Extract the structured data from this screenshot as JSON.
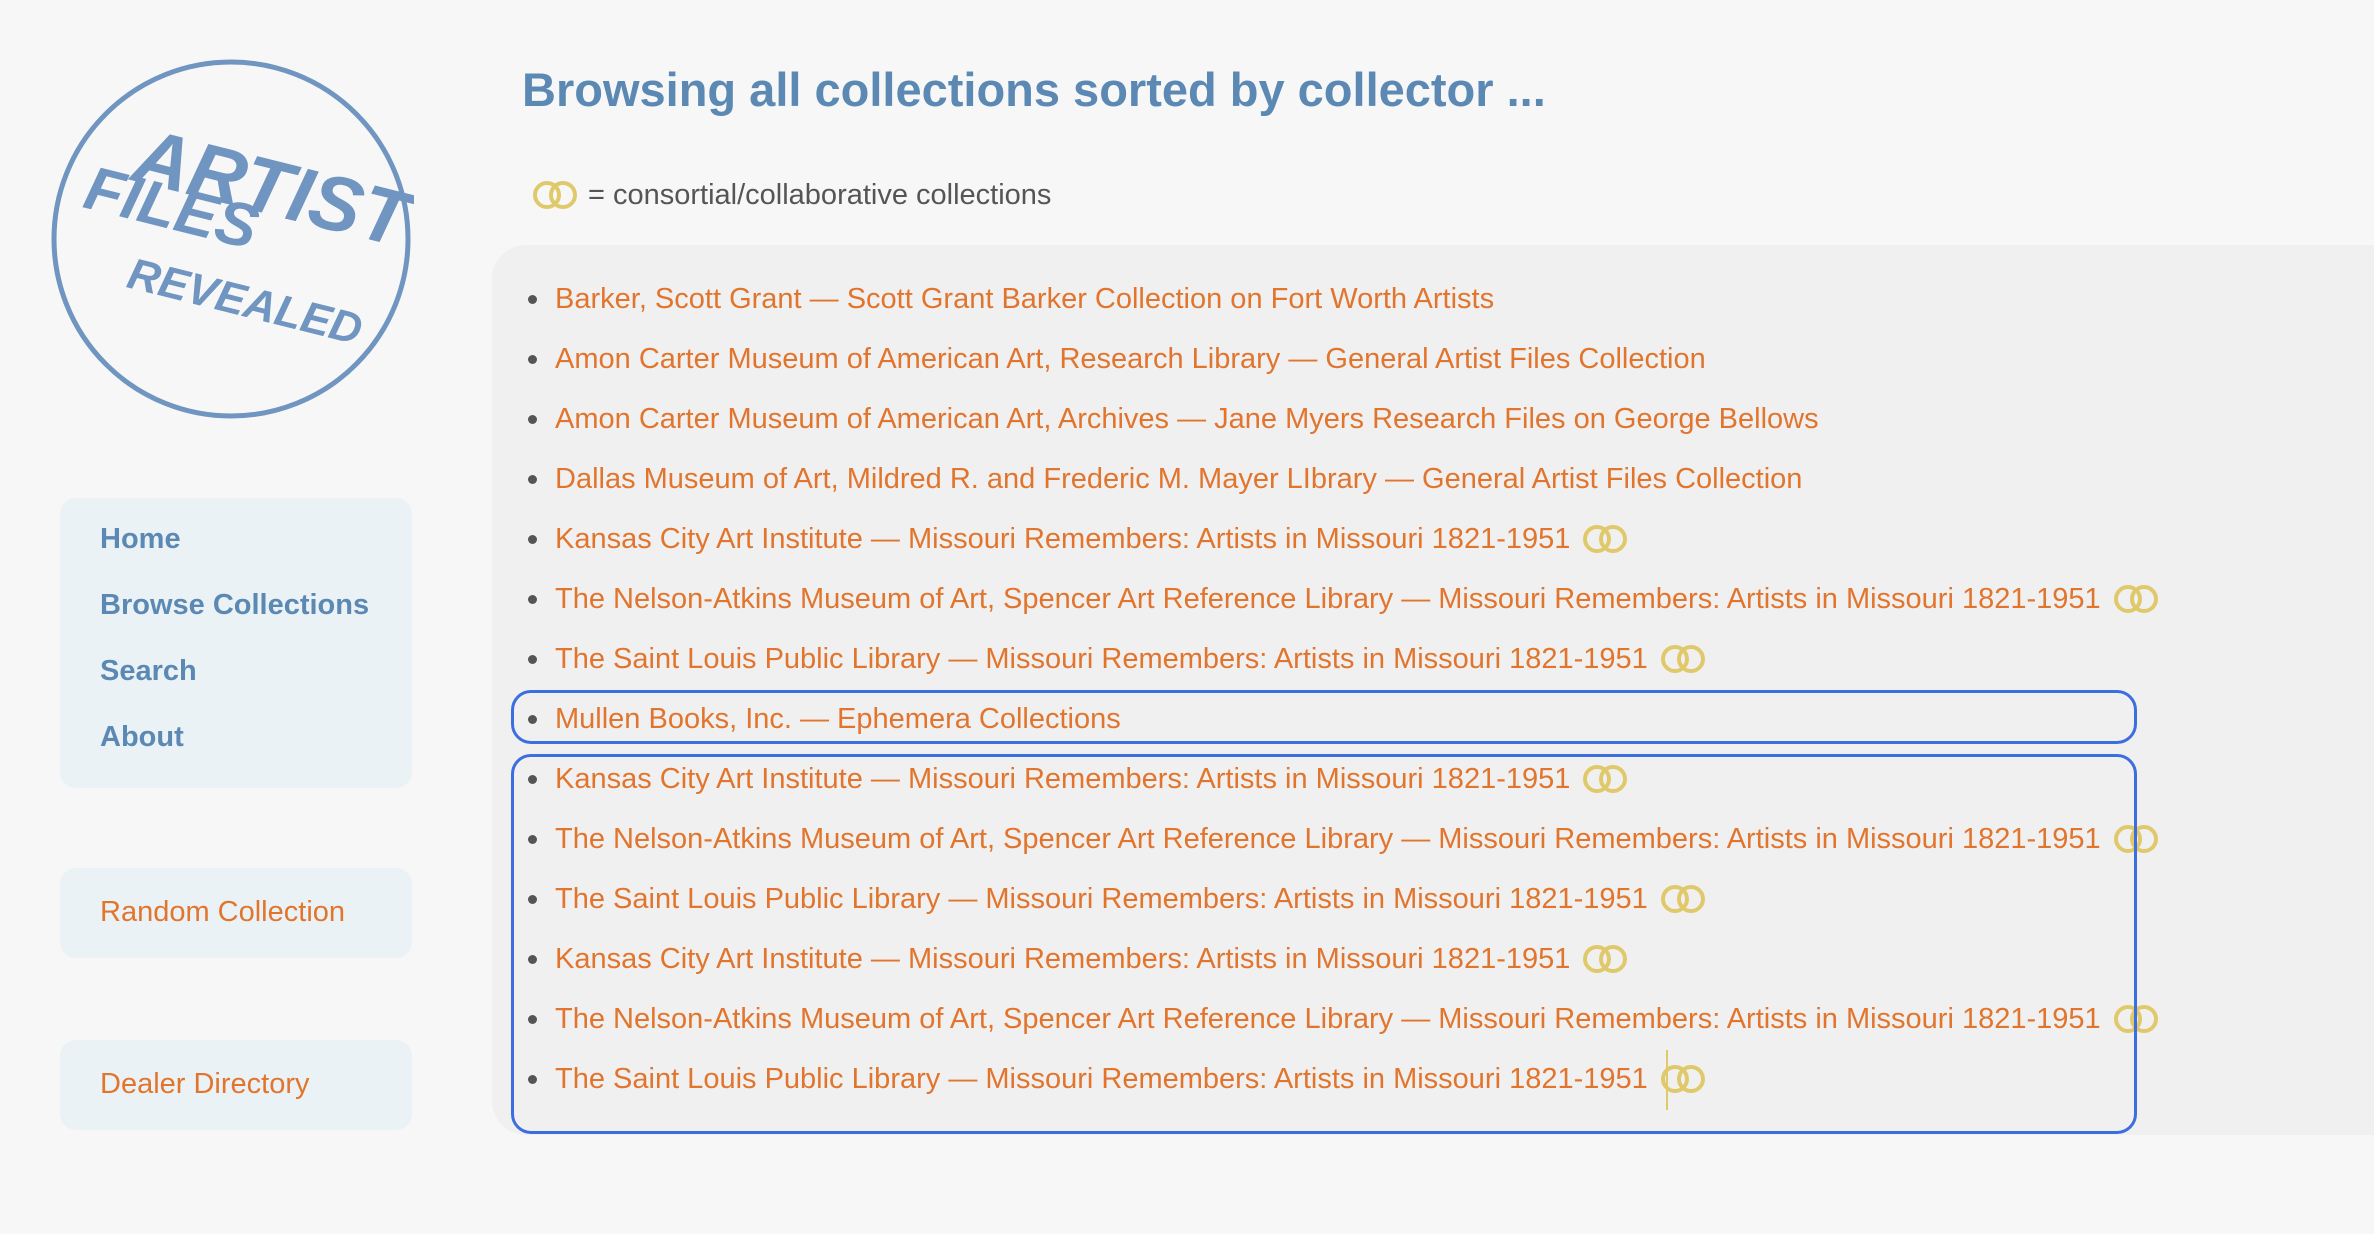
{
  "logo": {
    "line1": "ARTIST",
    "line2": "FILES",
    "line3": "REVEALED"
  },
  "page_title": "Browsing all collections sorted by collector ...",
  "legend": {
    "icon": "consortial-rings-icon",
    "text": "= consortial/collaborative collections"
  },
  "nav": {
    "items": [
      {
        "label": "Home"
      },
      {
        "label": "Browse Collections"
      },
      {
        "label": "Search"
      },
      {
        "label": "About"
      }
    ],
    "random": "Random Collection",
    "dealer": "Dealer Directory"
  },
  "colors": {
    "accent_blue": "#5b89b3",
    "link_orange": "#e2752d",
    "ring_gold": "#e0c96b",
    "highlight_blue": "#3d6ee0"
  },
  "collections": [
    {
      "text": "Barker, Scott Grant — Scott Grant Barker Collection on Fort Worth Artists",
      "consortial": false
    },
    {
      "text": "Amon Carter Museum of American Art, Research Library — General Artist Files Collection",
      "consortial": false
    },
    {
      "text": "Amon Carter Museum of American Art, Archives — Jane Myers Research Files on George Bellows",
      "consortial": false
    },
    {
      "text": "Dallas Museum of Art, Mildred R. and Frederic M. Mayer LIbrary — General Artist Files Collection",
      "consortial": false
    },
    {
      "text": "Kansas City Art Institute — Missouri Remembers: Artists in Missouri 1821-1951",
      "consortial": true
    },
    {
      "text": "The Nelson-Atkins Museum of Art, Spencer Art Reference Library — Missouri Remembers: Artists in Missouri 1821-1951",
      "consortial": true
    },
    {
      "text": "The Saint Louis Public Library — Missouri Remembers: Artists in Missouri 1821-1951",
      "consortial": true
    },
    {
      "text": "Mullen Books, Inc. — Ephemera Collections",
      "consortial": false
    },
    {
      "text": "Kansas City Art Institute — Missouri Remembers: Artists in Missouri 1821-1951",
      "consortial": true
    },
    {
      "text": "The Nelson-Atkins Museum of Art, Spencer Art Reference Library — Missouri Remembers: Artists in Missouri 1821-1951",
      "consortial": true
    },
    {
      "text": "The Saint Louis Public Library — Missouri Remembers: Artists in Missouri 1821-1951",
      "consortial": true
    },
    {
      "text": "Kansas City Art Institute — Missouri Remembers: Artists in Missouri 1821-1951",
      "consortial": true
    },
    {
      "text": "The Nelson-Atkins Museum of Art, Spencer Art Reference Library — Missouri Remembers: Artists in Missouri 1821-1951",
      "consortial": true
    },
    {
      "text": "The Saint Louis Public Library — Missouri Remembers: Artists in Missouri 1821-1951",
      "consortial": true
    }
  ]
}
